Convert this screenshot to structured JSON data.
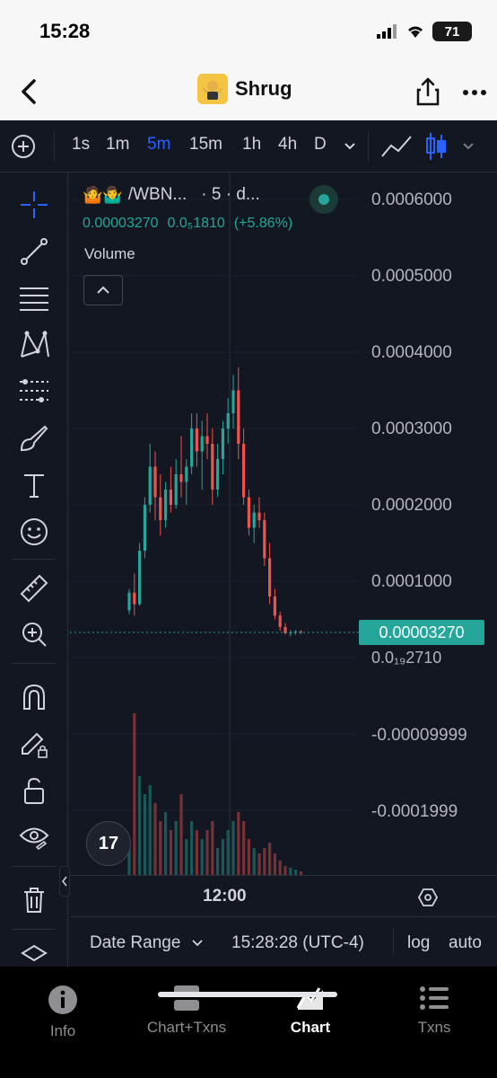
{
  "status_bar": {
    "time": "15:28",
    "battery": "71"
  },
  "nav": {
    "title": "Shrug",
    "icon": "shrug-emoji-icon"
  },
  "toolbar": {
    "add": "add-indicator-icon",
    "intervals": [
      "1s",
      "1m",
      "5m",
      "15m",
      "1h",
      "4h",
      "D"
    ],
    "active_interval": "5m"
  },
  "left_tools": [
    "crosshair-icon",
    "trendline-icon",
    "fib-lines-icon",
    "pattern-icon",
    "forecast-icon",
    "brush-icon",
    "text-icon",
    "emoji-icon",
    "ruler-icon",
    "zoom-in-icon",
    "magnet-icon",
    "lock-drawing-icon",
    "unlock-icon",
    "eye-icon",
    "trash-icon",
    "layers-icon"
  ],
  "legend": {
    "icons": "🤷🤷‍♂️",
    "symbol": "/WBN...",
    "interval": "· 5 · d...",
    "price": "0.00003270",
    "change_abs": "0.0₅1810",
    "change_pct": "(+5.86%)",
    "volume_label": "Volume"
  },
  "price_axis": [
    "0.0006000",
    "0.0005000",
    "0.0004000",
    "0.0003000",
    "0.0002000",
    "0.0001000",
    "-0.00009999",
    "-0.0001999"
  ],
  "current_price": "0.00003270",
  "current_price_sub": "0.0₁₉2710",
  "time_axis": {
    "label": "12:00"
  },
  "bottom_row": {
    "date_range": "Date Range",
    "clock": "15:28:28 (UTC-4)",
    "log": "log",
    "auto": "auto"
  },
  "tabs": [
    {
      "label": "Info",
      "icon": "info-icon"
    },
    {
      "label": "Chart+Txns",
      "icon": "split-view-icon"
    },
    {
      "label": "Chart",
      "icon": "chart-icon"
    },
    {
      "label": "Txns",
      "icon": "list-icon"
    }
  ],
  "active_tab": "Chart",
  "colors": {
    "bg": "#131722",
    "up": "#26a69a",
    "down": "#ef5350",
    "accent": "#2962ff"
  },
  "chart_data": {
    "type": "candlestick",
    "interval": "5m",
    "ylim": [
      -0.0002,
      0.0006
    ],
    "candles": [
      [
        6.2e-05,
        9e-05,
        5.7e-05,
        8.5e-05
      ],
      [
        8.5e-05,
        0.00011,
        5.5e-05,
        7e-05
      ],
      [
        7e-05,
        0.00015,
        6.8e-05,
        0.00014
      ],
      [
        0.00014,
        0.00021,
        0.00013,
        0.0002
      ],
      [
        0.0002,
        0.00028,
        0.00019,
        0.00025
      ],
      [
        0.00025,
        0.00027,
        0.00018,
        0.00021
      ],
      [
        0.00021,
        0.00024,
        0.00016,
        0.00018
      ],
      [
        0.00018,
        0.00023,
        0.00017,
        0.00022
      ],
      [
        0.00022,
        0.00025,
        0.00019,
        0.0002
      ],
      [
        0.0002,
        0.00026,
        0.000195,
        0.00024
      ],
      [
        0.00024,
        0.00029,
        0.00021,
        0.00023
      ],
      [
        0.00023,
        0.00026,
        0.0002,
        0.00025
      ],
      [
        0.00025,
        0.00032,
        0.00024,
        0.0003
      ],
      [
        0.0003,
        0.00032,
        0.00025,
        0.00027
      ],
      [
        0.00027,
        0.00031,
        0.00022,
        0.00029
      ],
      [
        0.00029,
        0.00032,
        0.00026,
        0.00028
      ],
      [
        0.00028,
        0.0003,
        0.0002,
        0.00022
      ],
      [
        0.00022,
        0.00028,
        0.00021,
        0.00026
      ],
      [
        0.00026,
        0.00031,
        0.00024,
        0.0003
      ],
      [
        0.0003,
        0.00034,
        0.00028,
        0.00032
      ],
      [
        0.00032,
        0.00037,
        0.0003,
        0.00035
      ],
      [
        0.00035,
        0.00038,
        0.00026,
        0.00028
      ],
      [
        0.00028,
        0.0003,
        0.0002,
        0.00021
      ],
      [
        0.00021,
        0.00022,
        0.00016,
        0.00017
      ],
      [
        0.00017,
        0.0002,
        0.00015,
        0.00019
      ],
      [
        0.00019,
        0.00021,
        0.00017,
        0.00018
      ],
      [
        0.00018,
        0.00019,
        0.00012,
        0.00013
      ],
      [
        0.00013,
        0.00015,
        7e-05,
        8e-05
      ],
      [
        8e-05,
        9e-05,
        5e-05,
        5.5e-05
      ],
      [
        5.5e-05,
        6e-05,
        3.5e-05,
        4e-05
      ],
      [
        4e-05,
        4.5e-05,
        3e-05,
        3.2e-05
      ],
      [
        3.2e-05,
        3.6e-05,
        2.8e-05,
        3.3e-05
      ],
      [
        3.3e-05,
        3.6e-05,
        3e-05,
        3.4e-05
      ],
      [
        3.4e-05,
        3.6e-05,
        3.1e-05,
        3.3e-05
      ]
    ],
    "volumes": [
      0.2,
      0.9,
      0.55,
      0.45,
      0.5,
      0.4,
      0.3,
      0.35,
      0.25,
      0.3,
      0.45,
      0.2,
      0.3,
      0.25,
      0.2,
      0.25,
      0.3,
      0.15,
      0.2,
      0.25,
      0.3,
      0.35,
      0.3,
      0.2,
      0.15,
      0.12,
      0.15,
      0.18,
      0.12,
      0.08,
      0.05,
      0.04,
      0.03,
      0.02
    ]
  }
}
